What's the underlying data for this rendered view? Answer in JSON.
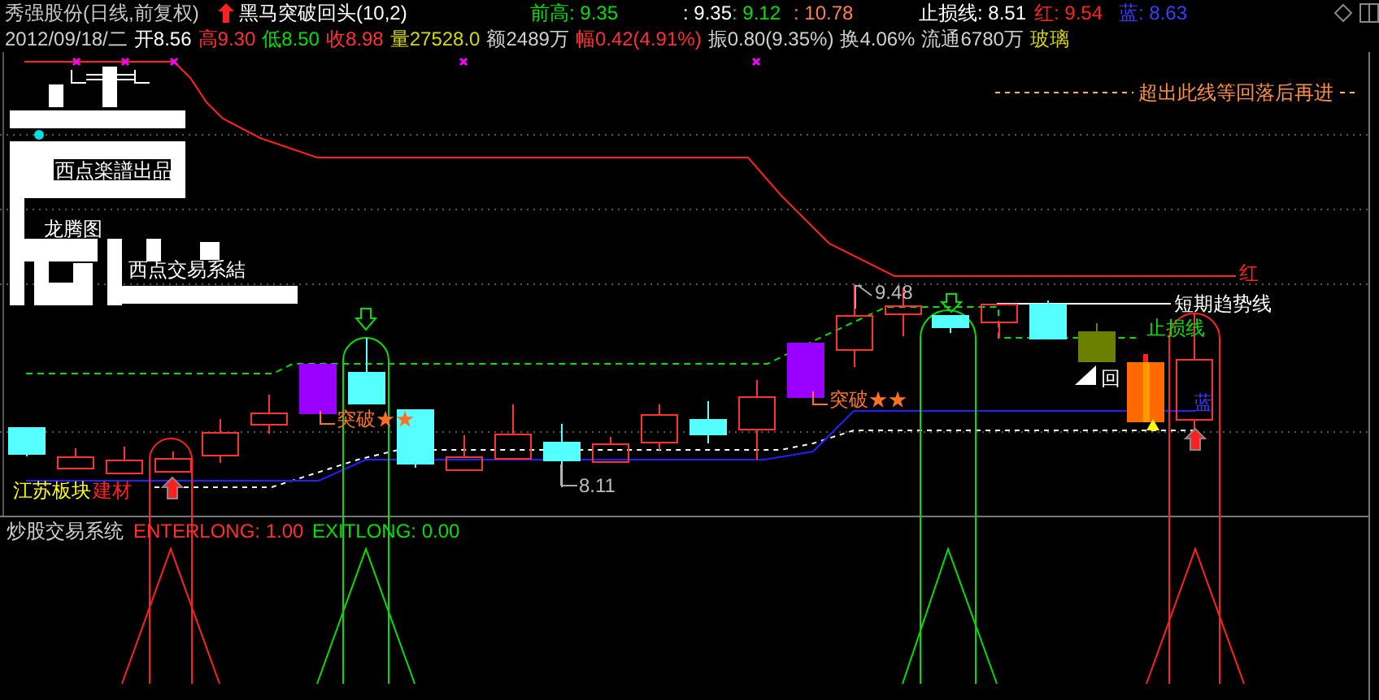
{
  "header": {
    "title": "秀强股份(日线,前复权)",
    "indicator": "黑马突破回头(10,2)",
    "readings": [
      {
        "text": "前高: 9.35",
        "color": "#00e000"
      },
      {
        "text": ": 9.35",
        "color": "#ffffff"
      },
      {
        "text": ": 9.12",
        "color": "#00e000"
      },
      {
        "text": ": 10.78",
        "color": "#ff7f50"
      },
      {
        "text": "止损线: 8.51",
        "color": "#ffffff"
      },
      {
        "text": "红: 9.54",
        "color": "#ff2020"
      },
      {
        "text": "蓝: 8.63",
        "color": "#3c3cff"
      }
    ],
    "quote": [
      {
        "text": "2012/09/18/二",
        "color": "#d0d0d0"
      },
      {
        "text": "开8.56",
        "color": "#ffffff"
      },
      {
        "text": "高9.30",
        "color": "#ff3030"
      },
      {
        "text": "低8.50",
        "color": "#00e000"
      },
      {
        "text": "收8.98",
        "color": "#ff3030"
      },
      {
        "text": "量27528.0",
        "color": "#d8d800"
      },
      {
        "text": "额2489万",
        "color": "#d0d0d0"
      },
      {
        "text": "幅0.42(4.91%)",
        "color": "#ff3030"
      },
      {
        "text": "振0.80(9.35%)",
        "color": "#d0d0d0"
      },
      {
        "text": "换4.06%",
        "color": "#d0d0d0"
      },
      {
        "text": "流通6780万",
        "color": "#d0d0d0"
      },
      {
        "text": "玻璃",
        "color": "#d8d800"
      }
    ]
  },
  "chart": {
    "resistance_note": "超出此线等回落后再进",
    "logo_texts": [
      "西点楽譜出品",
      "龙腾图",
      "西点交易系結"
    ],
    "high_label": "9.48",
    "low_label": "8.11",
    "breakout_labels": [
      "突破★★",
      "突破★★"
    ],
    "trend_label": "短期趋势线",
    "stop_label": "止损线",
    "red_label": "红",
    "blue_label": "蓝",
    "pullback_label": "回",
    "sector": "江苏板块",
    "industry": "建材"
  },
  "lower": {
    "title": "炒股交易系统",
    "values": [
      {
        "text": "ENTERLONG: 1.00",
        "color": "#ff3030"
      },
      {
        "text": "EXITLONG: 0.00",
        "color": "#00e000"
      }
    ]
  }
}
